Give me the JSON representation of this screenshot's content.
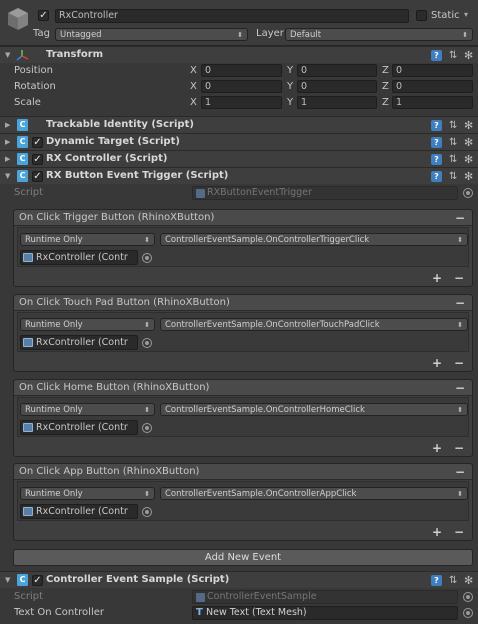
{
  "gameobject": {
    "name": "RxController",
    "active": true,
    "static_label": "Static",
    "static_checked": false,
    "tag_label": "Tag",
    "tag_value": "Untagged",
    "layer_label": "Layer",
    "layer_value": "Default"
  },
  "transform": {
    "title": "Transform",
    "rows": [
      {
        "label": "Position",
        "x": "0",
        "y": "0",
        "z": "0"
      },
      {
        "label": "Rotation",
        "x": "0",
        "y": "0",
        "z": "0"
      },
      {
        "label": "Scale",
        "x": "1",
        "y": "1",
        "z": "1"
      }
    ],
    "axis_x": "X",
    "axis_y": "Y",
    "axis_z": "Z"
  },
  "components": [
    {
      "title": "Trackable Identity (Script)",
      "has_checkbox": false
    },
    {
      "title": "Dynamic Target (Script)",
      "has_checkbox": true
    },
    {
      "title": "RX Controller (Script)",
      "has_checkbox": true
    },
    {
      "title": "RX Button Event Trigger (Script)",
      "has_checkbox": true
    }
  ],
  "trigger": {
    "script_label": "Script",
    "script_value": "RXButtonEventTrigger",
    "events": [
      {
        "title": "On Click Trigger Button (RhinoXButton)",
        "mode": "Runtime Only",
        "function": "ControllerEventSample.OnControllerTriggerClick",
        "target": "RxController (Contr"
      },
      {
        "title": "On Click Touch Pad Button (RhinoXButton)",
        "mode": "Runtime Only",
        "function": "ControllerEventSample.OnControllerTouchPadClick",
        "target": "RxController (Contr"
      },
      {
        "title": "On Click Home Button (RhinoXButton)",
        "mode": "Runtime Only",
        "function": "ControllerEventSample.OnControllerHomeClick",
        "target": "RxController (Contr"
      },
      {
        "title": "On Click App Button (RhinoXButton)",
        "mode": "Runtime Only",
        "function": "ControllerEventSample.OnControllerAppClick",
        "target": "RxController (Contr"
      }
    ],
    "add_event_label": "Add New Event",
    "minus": "−",
    "plus": "+"
  },
  "sample": {
    "title": "Controller Event Sample (Script)",
    "script_label": "Script",
    "script_value": "ControllerEventSample",
    "text_label": "Text On Controller",
    "text_value": "New Text (Text Mesh)"
  },
  "icons": {
    "help": "?",
    "presets": "⇅",
    "gear": "✻"
  },
  "colors": {
    "background": "#383838",
    "header": "#3e3e3e",
    "field": "#2a2a2a",
    "accent": "#3f7fc0"
  }
}
